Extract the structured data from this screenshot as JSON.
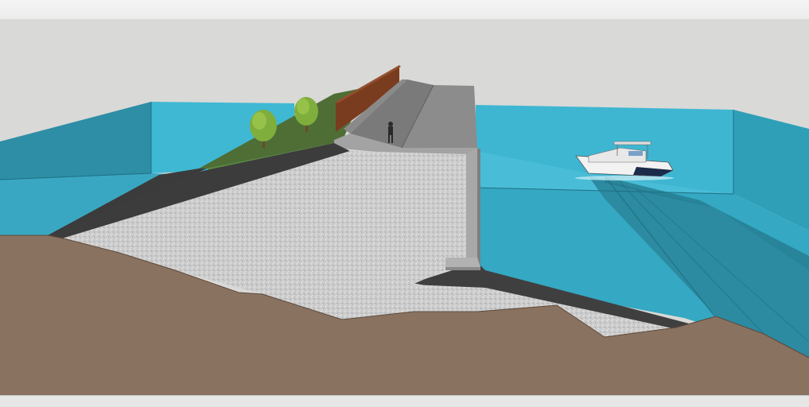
{
  "app": {
    "window_title": ""
  },
  "scene": {
    "objects": [
      "sky-background",
      "water-box-left",
      "water-box-right",
      "grass-embankment",
      "trees",
      "rust-colored-wall",
      "concrete-ramp-deck",
      "person-figure",
      "gravel-fill",
      "dark-riprap",
      "concrete-retaining-wall",
      "motor-boat",
      "soil-cross-section"
    ]
  },
  "colors": {
    "sky": "#d9d9d7",
    "water_light": "#3eb6d2",
    "water_mid": "#2f9fb8",
    "water_dark": "#2a7f94",
    "soil": "#8a7260",
    "soil_dark": "#6e5a4b",
    "gravel": "#cfcfcf",
    "riprap": "#4a4a4a",
    "concrete": "#9a9a9a",
    "concrete_dark": "#6f6f6f",
    "grass": "#4e6e36",
    "wall_rust": "#7a3c1e",
    "tree": "#7fae3c"
  }
}
